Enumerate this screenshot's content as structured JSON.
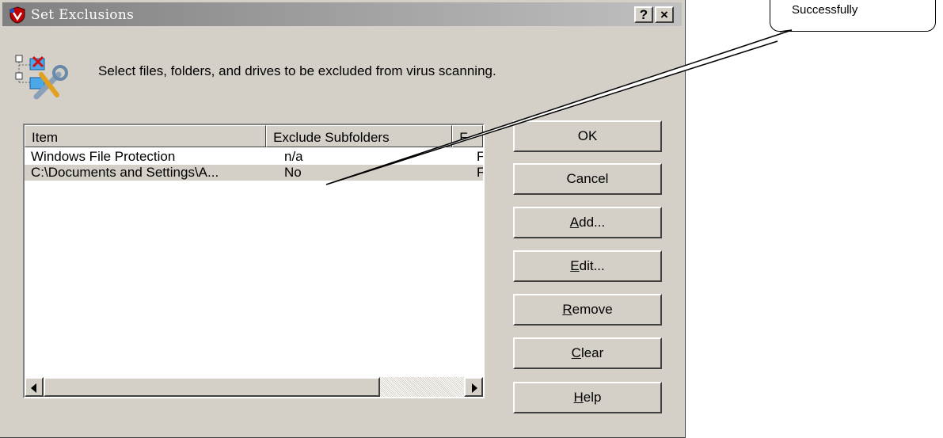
{
  "window": {
    "title": "Set Exclusions",
    "help_button": "?",
    "close_button": "×"
  },
  "header": {
    "text": "Select files, folders, and drives to be excluded from virus scanning."
  },
  "list": {
    "columns": [
      "Item",
      "Exclude Subfolders",
      "F"
    ],
    "rows": [
      {
        "item": "Windows File Protection",
        "exclude_subfolders": "n/a",
        "extra": "F"
      },
      {
        "item": "C:\\Documents and Settings\\A...",
        "exclude_subfolders": "No",
        "extra": "F"
      }
    ],
    "selected_row": 1
  },
  "buttons": {
    "ok": "OK",
    "cancel": "Cancel",
    "add": {
      "mnemonic": "A",
      "rest": "dd..."
    },
    "edit": {
      "mnemonic": "E",
      "rest": "dit..."
    },
    "remove": {
      "mnemonic": "R",
      "rest": "emove"
    },
    "clear": {
      "mnemonic": "C",
      "rest": "lear"
    },
    "help": {
      "mnemonic": "H",
      "rest": "elp"
    }
  },
  "callout": {
    "text": "Successfully"
  },
  "colors": {
    "dialog_face": "#d4d0c8",
    "title_gradient_start": "#808080",
    "title_gradient_end": "#c0c0c0",
    "list_background": "#ffffff"
  },
  "icons": {
    "title": "shield-icon",
    "header": "exclusion-tools-icon"
  }
}
